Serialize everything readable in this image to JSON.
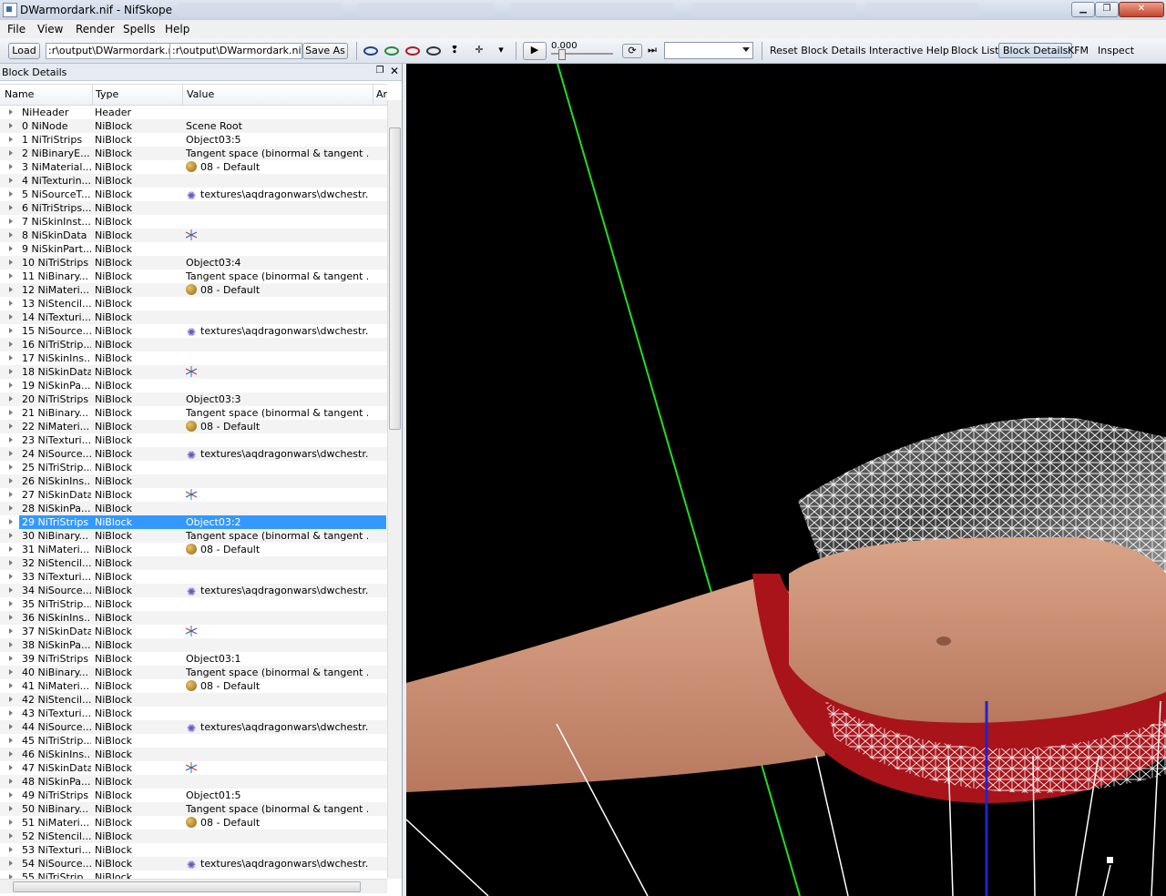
{
  "window": {
    "title": "DWarmordark.nif - NifSkope"
  },
  "menubar": {
    "items": [
      "File",
      "View",
      "Render",
      "Spells",
      "Help"
    ]
  },
  "toolbar": {
    "load_label": "Load",
    "load_path": ":r\\output\\DWarmordark.nif",
    "save_path": ":r\\output\\DWarmordark.nif",
    "save_as_label": "Save As",
    "play_label": "▶",
    "time_value": "0.000",
    "reset_block_details": "Reset Block Details",
    "interactive_help": "Interactive Help",
    "block_list": "Block List",
    "block_details": "Block Details",
    "kfm": "KFM",
    "inspect": "Inspect"
  },
  "dock": {
    "title": "Block Details"
  },
  "columns": {
    "name": "Name",
    "type": "Type",
    "value": "Value",
    "extra": "Ar"
  },
  "colors": {
    "selection": "#3399ff",
    "axis_green": "#22dd22",
    "cloth_red": "#b0151a",
    "skin": "#c99072"
  },
  "rows": [
    {
      "name": "NiHeader",
      "type": "Header",
      "value": "",
      "icon": ""
    },
    {
      "name": "0 NiNode",
      "type": "NiBlock",
      "value": "Scene Root",
      "icon": ""
    },
    {
      "name": "1 NiTriStrips",
      "type": "NiBlock",
      "value": "Object03:5",
      "icon": ""
    },
    {
      "name": "2 NiBinaryE...",
      "type": "NiBlock",
      "value": "Tangent space (binormal & tangent ...",
      "icon": ""
    },
    {
      "name": "3 NiMaterial...",
      "type": "NiBlock",
      "value": "08 - Default",
      "icon": "material-icon"
    },
    {
      "name": "4 NiTexturin...",
      "type": "NiBlock",
      "value": "",
      "icon": ""
    },
    {
      "name": "5 NiSourceT...",
      "type": "NiBlock",
      "value": "textures\\aqdragonwars\\dwchestr...",
      "icon": "texture-icon"
    },
    {
      "name": "6 NiTriStrips...",
      "type": "NiBlock",
      "value": "",
      "icon": ""
    },
    {
      "name": "7 NiSkinInst...",
      "type": "NiBlock",
      "value": "",
      "icon": ""
    },
    {
      "name": "8 NiSkinData",
      "type": "NiBlock",
      "value": "",
      "icon": "skin-icon"
    },
    {
      "name": "9 NiSkinPart...",
      "type": "NiBlock",
      "value": "",
      "icon": ""
    },
    {
      "name": "10 NiTriStrips",
      "type": "NiBlock",
      "value": "Object03:4",
      "icon": ""
    },
    {
      "name": "11 NiBinary...",
      "type": "NiBlock",
      "value": "Tangent space (binormal & tangent ...",
      "icon": ""
    },
    {
      "name": "12 NiMateri...",
      "type": "NiBlock",
      "value": "08 - Default",
      "icon": "material-icon"
    },
    {
      "name": "13 NiStencil...",
      "type": "NiBlock",
      "value": "",
      "icon": ""
    },
    {
      "name": "14 NiTexturi...",
      "type": "NiBlock",
      "value": "",
      "icon": ""
    },
    {
      "name": "15 NiSource...",
      "type": "NiBlock",
      "value": "textures\\aqdragonwars\\dwchestr...",
      "icon": "texture-icon"
    },
    {
      "name": "16 NiTriStrip...",
      "type": "NiBlock",
      "value": "",
      "icon": ""
    },
    {
      "name": "17 NiSkinIns...",
      "type": "NiBlock",
      "value": "",
      "icon": ""
    },
    {
      "name": "18 NiSkinData",
      "type": "NiBlock",
      "value": "",
      "icon": "skin-icon"
    },
    {
      "name": "19 NiSkinPa...",
      "type": "NiBlock",
      "value": "",
      "icon": ""
    },
    {
      "name": "20 NiTriStrips",
      "type": "NiBlock",
      "value": "Object03:3",
      "icon": ""
    },
    {
      "name": "21 NiBinary...",
      "type": "NiBlock",
      "value": "Tangent space (binormal & tangent ...",
      "icon": ""
    },
    {
      "name": "22 NiMateri...",
      "type": "NiBlock",
      "value": "08 - Default",
      "icon": "material-icon"
    },
    {
      "name": "23 NiTexturi...",
      "type": "NiBlock",
      "value": "",
      "icon": ""
    },
    {
      "name": "24 NiSource...",
      "type": "NiBlock",
      "value": "textures\\aqdragonwars\\dwchestr...",
      "icon": "texture-icon"
    },
    {
      "name": "25 NiTriStrip...",
      "type": "NiBlock",
      "value": "",
      "icon": ""
    },
    {
      "name": "26 NiSkinIns...",
      "type": "NiBlock",
      "value": "",
      "icon": ""
    },
    {
      "name": "27 NiSkinData",
      "type": "NiBlock",
      "value": "",
      "icon": "skin-icon"
    },
    {
      "name": "28 NiSkinPa...",
      "type": "NiBlock",
      "value": "",
      "icon": ""
    },
    {
      "name": "29 NiTriStrips",
      "type": "NiBlock",
      "value": "Object03:2",
      "icon": "",
      "selected": true
    },
    {
      "name": "30 NiBinary...",
      "type": "NiBlock",
      "value": "Tangent space (binormal & tangent ...",
      "icon": ""
    },
    {
      "name": "31 NiMateri...",
      "type": "NiBlock",
      "value": "08 - Default",
      "icon": "material-icon"
    },
    {
      "name": "32 NiStencil...",
      "type": "NiBlock",
      "value": "",
      "icon": ""
    },
    {
      "name": "33 NiTexturi...",
      "type": "NiBlock",
      "value": "",
      "icon": ""
    },
    {
      "name": "34 NiSource...",
      "type": "NiBlock",
      "value": "textures\\aqdragonwars\\dwchestr...",
      "icon": "texture-icon"
    },
    {
      "name": "35 NiTriStrip...",
      "type": "NiBlock",
      "value": "",
      "icon": ""
    },
    {
      "name": "36 NiSkinIns...",
      "type": "NiBlock",
      "value": "",
      "icon": ""
    },
    {
      "name": "37 NiSkinData",
      "type": "NiBlock",
      "value": "",
      "icon": "skin-icon"
    },
    {
      "name": "38 NiSkinPa...",
      "type": "NiBlock",
      "value": "",
      "icon": ""
    },
    {
      "name": "39 NiTriStrips",
      "type": "NiBlock",
      "value": "Object03:1",
      "icon": ""
    },
    {
      "name": "40 NiBinary...",
      "type": "NiBlock",
      "value": "Tangent space (binormal & tangent ...",
      "icon": ""
    },
    {
      "name": "41 NiMateri...",
      "type": "NiBlock",
      "value": "08 - Default",
      "icon": "material-icon"
    },
    {
      "name": "42 NiStencil...",
      "type": "NiBlock",
      "value": "",
      "icon": ""
    },
    {
      "name": "43 NiTexturi...",
      "type": "NiBlock",
      "value": "",
      "icon": ""
    },
    {
      "name": "44 NiSource...",
      "type": "NiBlock",
      "value": "textures\\aqdragonwars\\dwchestr...",
      "icon": "texture-icon"
    },
    {
      "name": "45 NiTriStrip...",
      "type": "NiBlock",
      "value": "",
      "icon": ""
    },
    {
      "name": "46 NiSkinIns...",
      "type": "NiBlock",
      "value": "",
      "icon": ""
    },
    {
      "name": "47 NiSkinData",
      "type": "NiBlock",
      "value": "",
      "icon": "skin-icon"
    },
    {
      "name": "48 NiSkinPa...",
      "type": "NiBlock",
      "value": "",
      "icon": ""
    },
    {
      "name": "49 NiTriStrips",
      "type": "NiBlock",
      "value": "Object01:5",
      "icon": ""
    },
    {
      "name": "50 NiBinary...",
      "type": "NiBlock",
      "value": "Tangent space (binormal & tangent ...",
      "icon": ""
    },
    {
      "name": "51 NiMateri...",
      "type": "NiBlock",
      "value": "08 - Default",
      "icon": "material-icon"
    },
    {
      "name": "52 NiStencil...",
      "type": "NiBlock",
      "value": "",
      "icon": ""
    },
    {
      "name": "53 NiTexturi...",
      "type": "NiBlock",
      "value": "",
      "icon": ""
    },
    {
      "name": "54 NiSource...",
      "type": "NiBlock",
      "value": "textures\\aqdragonwars\\dwchestr...",
      "icon": "texture-icon"
    },
    {
      "name": "55 NiTriStrip...",
      "type": "NiBlock",
      "value": "",
      "icon": ""
    }
  ]
}
